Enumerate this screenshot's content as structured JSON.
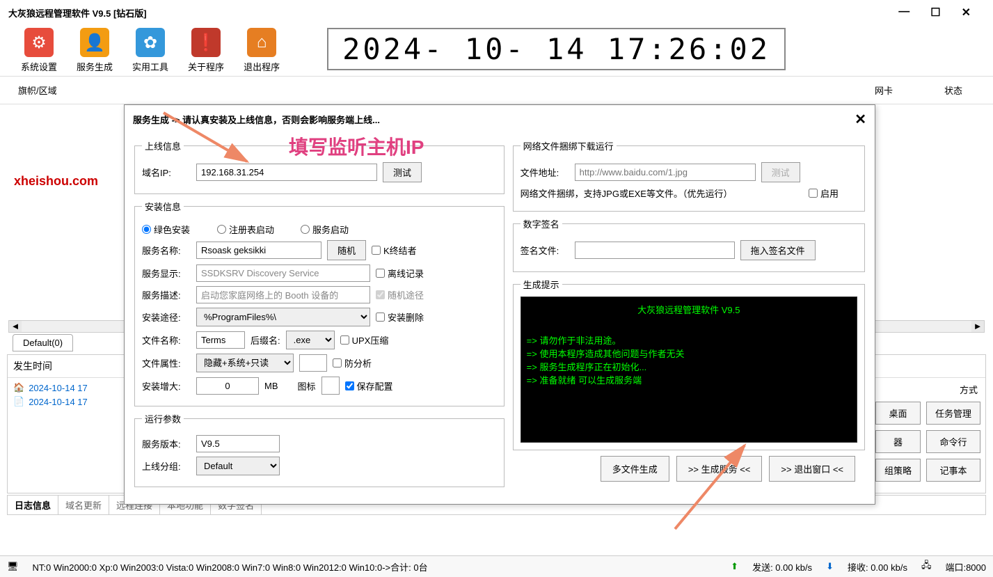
{
  "window": {
    "title": "大灰狼远程管理软件 V9.5 [钻石版]",
    "minimize": "—",
    "maximize": "☐",
    "close": "✕"
  },
  "toolbar": {
    "items": [
      {
        "label": "系统设置",
        "color": "#e74c3c",
        "glyph": "⚙"
      },
      {
        "label": "服务生成",
        "color": "#f39c12",
        "glyph": "👤"
      },
      {
        "label": "实用工具",
        "color": "#3498db",
        "glyph": "✿"
      },
      {
        "label": "关于程序",
        "color": "#c0392b",
        "glyph": "❗"
      },
      {
        "label": "退出程序",
        "color": "#e67e22",
        "glyph": "⌂"
      }
    ],
    "clock": "2024- 10- 14  17:26:02"
  },
  "grid": {
    "col_flag": "旗帜/区域",
    "col_nic": "网卡",
    "col_status": "状态"
  },
  "tab_default": "Default(0)",
  "watermark": "xheishou.com",
  "log": {
    "header": "发生时间",
    "rows": [
      {
        "icon": "🏠",
        "text": "2024-10-14 17"
      },
      {
        "icon": "📄",
        "text": "2024-10-14 17"
      }
    ]
  },
  "side_buttons": {
    "way": "方式",
    "desktop": "桌面",
    "task_mgr": "任务管理",
    "device": "器",
    "cmdline": "命令行",
    "gpedit": "组策略",
    "notepad": "记事本"
  },
  "bottom_tabs": [
    "日志信息",
    "域名更新",
    "远程连接",
    "本地功能",
    "数字签名"
  ],
  "statusbar": {
    "os": "NT:0 Win2000:0 Xp:0 Win2003:0 Vista:0 Win2008:0 Win7:0 Win8:0 Win2012:0 Win10:0->合计: 0台",
    "send": "发送: 0.00 kb/s",
    "recv": "接收: 0.00 kb/s",
    "port": "端口:8000"
  },
  "dialog": {
    "title": "服务生成 -> 请认真安装及上线信息，否则会影响服务端上线...",
    "annotation": "填写监听主机IP",
    "online": {
      "legend": "上线信息",
      "ip_label": "域名IP:",
      "ip_value": "192.168.31.254",
      "test": "测试"
    },
    "install": {
      "legend": "安装信息",
      "r_green": "绿色安装",
      "r_reg": "注册表启动",
      "r_svc": "服务启动",
      "svc_name_label": "服务名称:",
      "svc_name": "Rsoask geksikki",
      "random": "随机",
      "k_terminator": "K终结者",
      "svc_disp_label": "服务显示:",
      "svc_disp": "SSDKSRV Discovery Service",
      "offline_log": "离线记录",
      "svc_desc_label": "服务描述:",
      "svc_desc": "启动您家庭网络上的 Booth 设备的",
      "random_path": "随机途径",
      "inst_path_label": "安装途径:",
      "inst_path": "%ProgramFiles%\\",
      "inst_delete": "安装删除",
      "file_name_label": "文件名称:",
      "file_name": "Terms",
      "ext_label": "后缀名:",
      "ext": ".exe",
      "upx": "UPX压缩",
      "file_attr_label": "文件属性:",
      "file_attr": "隐藏+系统+只读",
      "anti_analysis": "防分析",
      "install_size_label": "安装增大:",
      "install_size": "0",
      "mb": "MB",
      "icon_label": "图标",
      "save_config": "保存配置"
    },
    "runtime": {
      "legend": "运行参数",
      "ver_label": "服务版本:",
      "ver": "V9.5",
      "group_label": "上线分组:",
      "group": "Default"
    },
    "net": {
      "legend": "网络文件捆绑下载运行",
      "url_label": "文件地址:",
      "url_placeholder": "http://www.baidu.com/1.jpg",
      "test": "测试",
      "hint": "网络文件捆绑，支持JPG或EXE等文件。（优先运行）",
      "enable": "启用"
    },
    "sign": {
      "legend": "数字签名",
      "file_label": "签名文件:",
      "drop": "拖入签名文件"
    },
    "gen": {
      "legend": "生成提示",
      "console_title": "大灰狼远程管理软件 V9.5",
      "lines": [
        "=> 请勿作于非法用途。",
        "=> 使用本程序造成其他问题与作者无关",
        "=> 服务生成程序正在初始化...",
        "=> 准备就绪 可以生成服务端"
      ]
    },
    "footer": {
      "multi": "多文件生成",
      "generate": ">> 生成服务 <<",
      "exit": ">> 退出窗口 <<"
    }
  }
}
